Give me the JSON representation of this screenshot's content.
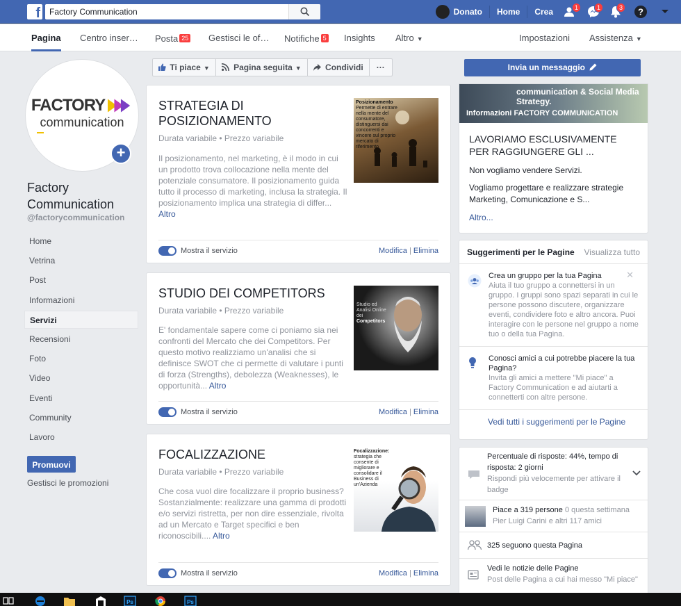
{
  "topbar": {
    "search_value": "Factory Communication",
    "user_name": "Donato",
    "home_label": "Home",
    "create_label": "Crea",
    "friend_badge": "1",
    "message_badge": "1",
    "notif_badge": "3"
  },
  "page_tabs": [
    {
      "label": "Pagina",
      "badge": ""
    },
    {
      "label": "Centro inser…",
      "badge": ""
    },
    {
      "label": "Posta",
      "badge": "25"
    },
    {
      "label": "Gestisci le of…",
      "badge": ""
    },
    {
      "label": "Notifiche",
      "badge": "5"
    },
    {
      "label": "Insights",
      "badge": ""
    },
    {
      "label": "Altro",
      "badge": ""
    }
  ],
  "page_tabs_right": {
    "settings": "Impostazioni",
    "help": "Assistenza"
  },
  "profile": {
    "logo_line1": "FACTORY",
    "logo_line2": "communication",
    "name": "Factory Communication",
    "handle": "@factorycommunication"
  },
  "left_nav": [
    "Home",
    "Vetrina",
    "Post",
    "Informazioni",
    "Servizi",
    "Recensioni",
    "Foto",
    "Video",
    "Eventi",
    "Community",
    "Lavoro"
  ],
  "left_nav_active": "Servizi",
  "promote": {
    "button": "Promuovi",
    "manage": "Gestisci le promozioni"
  },
  "action_bar": {
    "like": "Ti piace",
    "follow": "Pagina seguita",
    "share": "Condividi",
    "more": "···",
    "message": "Invia un messaggio"
  },
  "services": [
    {
      "title": "STRATEGIA DI POSIZIONAMENTO",
      "meta": "Durata variabile • Prezzo variabile",
      "desc": "Il posizionamento, nel marketing, è il modo in cui un prodotto trova collocazione nella mente del potenziale consumatore. Il posizionamento guida tutto il processo di marketing, inclusa la strategia. Il posizionamento implica una strategia di differ...",
      "more": "Altro",
      "thumb_title": "Posizionamento",
      "thumb_text": "Permette di entrare nella mente del consumatore, distinguersi dai concorrenti e vincere sul proprio mercato di riferimento"
    },
    {
      "title": "STUDIO DEI COMPETITORS",
      "meta": "Durata variabile • Prezzo variabile",
      "desc": "E' fondamentale sapere come ci poniamo sia nei confronti del Mercato che dei Competitors. Per questo motivo realizziamo un'analisi che si definisce SWOT che ci permette di valutare i punti di forza (Strengths), debolezza (Weaknesses), le opportunità...",
      "more": "Altro",
      "thumb_title": "Studio ed Analisi Online dei",
      "thumb_text": "Competitors"
    },
    {
      "title": "FOCALIZZAZIONE",
      "meta": "Durata variabile • Prezzo variabile",
      "desc": "Che cosa vuol dire focalizzare il proprio business? Sostanzialmente: realizzare una gamma di prodotti e/o servizi ristretta, per non dire essenziale, rivolta ad un Mercato e Target specifici e ben riconoscibili....",
      "more": "Altro",
      "thumb_title": "Focalizzazione:",
      "thumb_text": "strategia che consente di migliorare e consolidare il Business di un'Azienda"
    }
  ],
  "service_footer": {
    "show": "Mostra il servizio",
    "edit": "Modifica",
    "delete": "Elimina"
  },
  "about": {
    "banner_text": "communication & Social Media Strategy.",
    "banner_label": "Informazioni FACTORY COMMUNICATION",
    "heading": "LAVORIAMO ESCLUSIVAMENTE PER RAGGIUNGERE GLI ...",
    "p1": "Non vogliamo vendere Servizi.",
    "p2": "Vogliamo progettare e realizzare strategie Marketing, Comunicazione e S...",
    "more": "Altro..."
  },
  "suggestions": {
    "title": "Suggerimenti per le Pagine",
    "view_all": "Visualizza tutto",
    "items": [
      {
        "title": "Crea un gruppo per la tua Pagina",
        "desc": "Aiuta il tuo gruppo a connettersi in un gruppo. I gruppi sono spazi separati in cui le persone possono discutere, organizzare eventi, condividere foto e altro ancora. Puoi interagire con le persone nel gruppo a nome tuo o della tua Pagina."
      },
      {
        "title": "Conosci amici a cui potrebbe piacere la tua Pagina?",
        "desc": "Invita gli amici a mettere \"Mi piace\" a Factory Communication e ad aiutarti a connetterti con altre persone."
      }
    ],
    "see_all": "Vedi tutti i suggerimenti per le Pagine"
  },
  "stats": {
    "response": "Percentuale di risposte: 44%, tempo di risposta: 2 giorni",
    "response_sub": "Rispondi più velocemente per attivare il badge",
    "likes": "Piace a 319 persone",
    "likes_week": "0 questa settimana",
    "likes_friends": "Pier Luigi Carini e altri 117 amici",
    "follows": "325 seguono questa Pagina",
    "news": "Vedi le notizie delle Pagine",
    "news_sub": "Post delle Pagina a cui hai messo \"Mi piace\""
  },
  "colors": {
    "brand": "#4267b2",
    "badge": "#fa3e3e",
    "link": "#365899"
  }
}
